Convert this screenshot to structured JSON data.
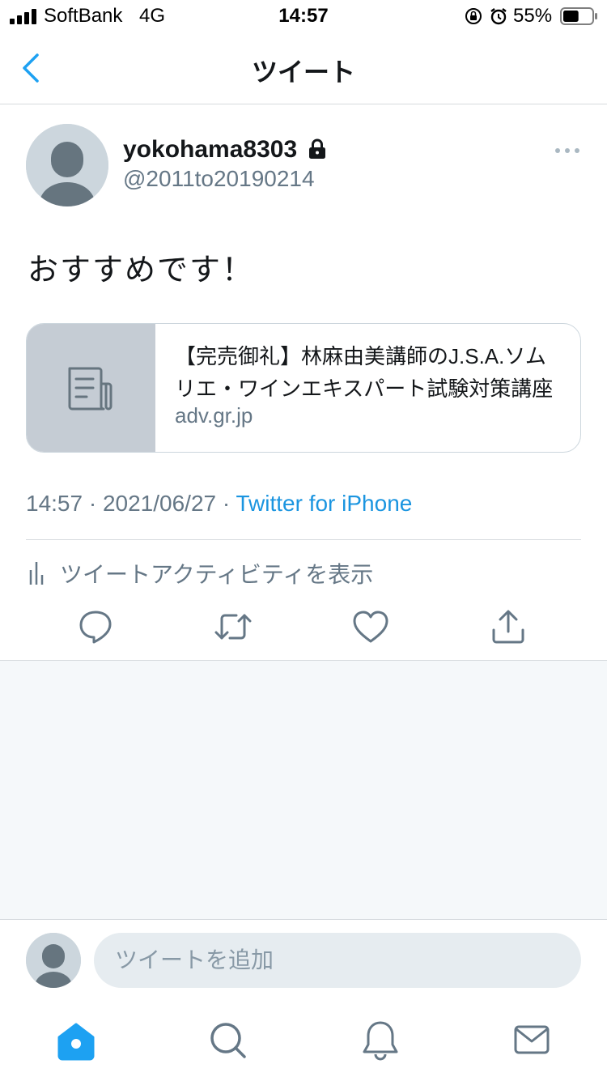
{
  "status_bar": {
    "carrier": "SoftBank",
    "network": "4G",
    "time": "14:57",
    "battery_percent": "55%",
    "battery_level": 0.55
  },
  "nav": {
    "title": "ツイート",
    "back_icon": "chevron-left-icon"
  },
  "tweet": {
    "display_name": "yokohama8303",
    "protected_icon": "lock-icon",
    "handle": "@2011to20190214",
    "text": "おすすめです！",
    "link_card": {
      "title": "【完売御礼】林麻由美講師のJ.S.A.ソムリエ・ワインエキスパート試験対策講座",
      "domain": "adv.gr.jp",
      "thumb_icon": "document-icon"
    },
    "timestamp": "14:57 · 2021/06/27 · ",
    "source": "Twitter for iPhone",
    "activity_label": "ツイートアクティビティを表示"
  },
  "actions": [
    "reply-icon",
    "retweet-icon",
    "like-icon",
    "share-icon"
  ],
  "reply": {
    "placeholder": "ツイートを追加"
  },
  "tabbar": [
    "home-icon",
    "search-icon",
    "notifications-icon",
    "messages-icon"
  ],
  "colors": {
    "accent": "#1da1f2",
    "link": "#1b95e0",
    "secondary_text": "#657786",
    "icon_gray": "#657786"
  }
}
